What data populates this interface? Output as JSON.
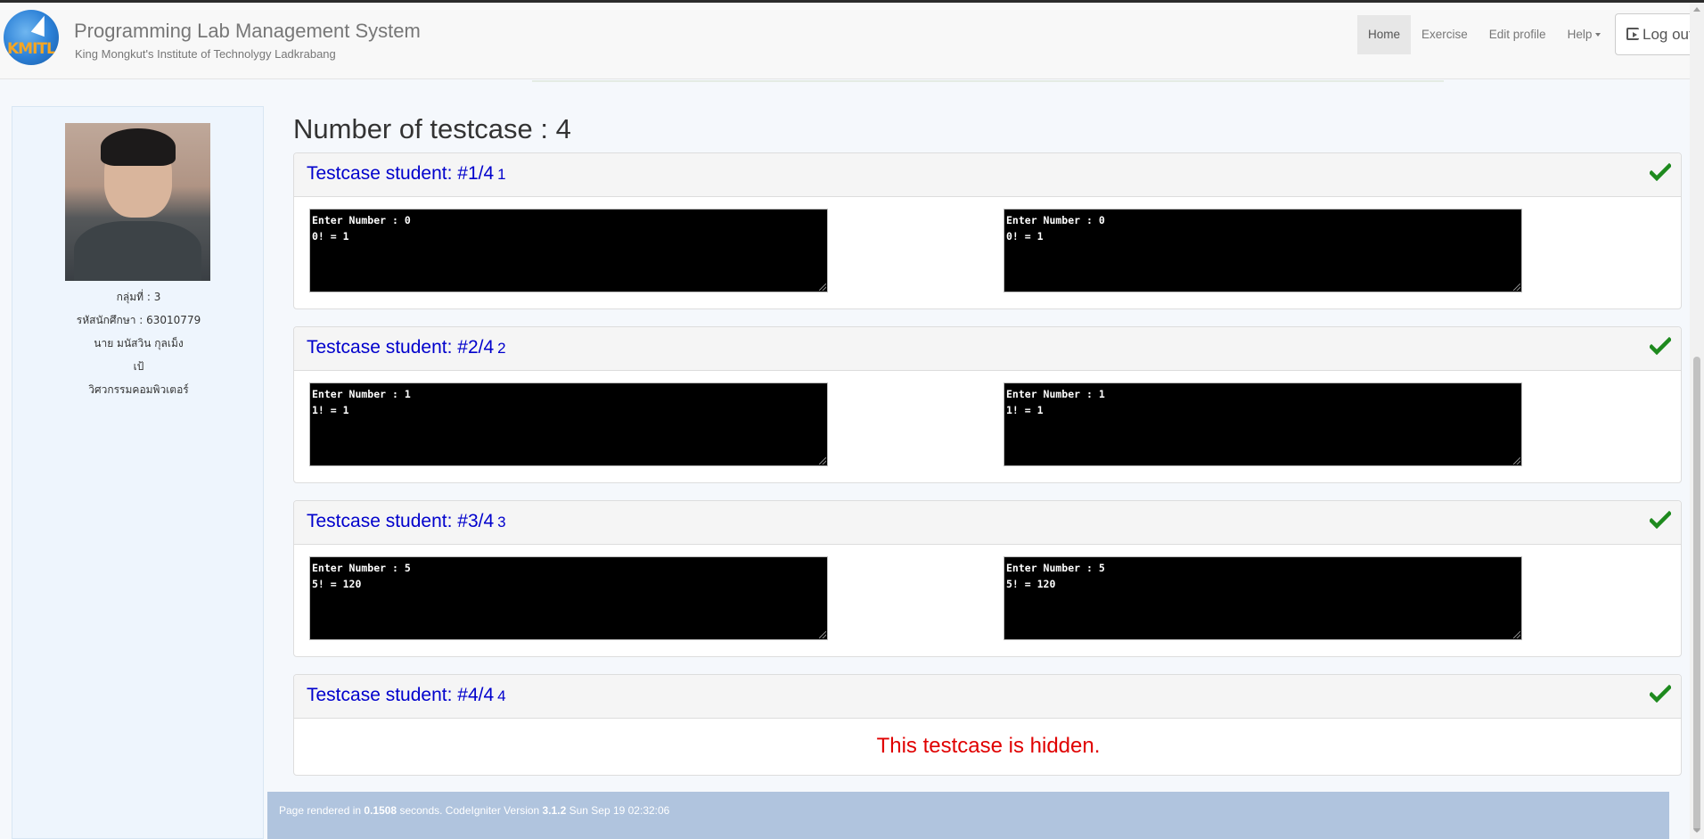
{
  "navbar": {
    "logo_text": "KMITL",
    "title": "Programming Lab Management System",
    "subtitle": "King Mongkut's Institute of Technolygy Ladkrabang",
    "links": [
      {
        "label": "Home",
        "active": true
      },
      {
        "label": "Exercise",
        "active": false
      },
      {
        "label": "Edit profile",
        "active": false
      },
      {
        "label": "Help",
        "active": false
      }
    ],
    "logout_label": "Log out"
  },
  "profile": {
    "group": "กลุ่มที่ : 3",
    "student_id": "รหัสนักศึกษา : 63010779",
    "name": "นาย มนัสวิน กุลเม็ง",
    "nickname": "เป้",
    "department": "วิศวกรรมคอมพิวเตอร์"
  },
  "main": {
    "testcase_count": "Number of testcase : 4",
    "testcases": [
      {
        "title": "Testcase student: #1/4",
        "num": "1",
        "status": "passed",
        "left_output": "Enter Number : 0\n0! = 1",
        "right_output": "Enter Number : 0\n0! = 1"
      },
      {
        "title": "Testcase student: #2/4",
        "num": "2",
        "status": "passed",
        "left_output": "Enter Number : 1\n1! = 1",
        "right_output": "Enter Number : 1\n1! = 1"
      },
      {
        "title": "Testcase student: #3/4",
        "num": "3",
        "status": "passed",
        "left_output": "Enter Number : 5\n5! = 120",
        "right_output": "Enter Number : 5\n5! = 120"
      },
      {
        "title": "Testcase student: #4/4",
        "num": "4",
        "status": "passed",
        "hidden_message": "This testcase is hidden."
      }
    ]
  },
  "footer": {
    "prefix": "Page rendered in ",
    "time": "0.1508",
    "middle": " seconds. CodeIgniter Version ",
    "version": "3.1.2",
    "date": " Sun Sep 19 02:32:06"
  },
  "colors": {
    "link_blue": "#0000cc",
    "check_green": "#1e8a1e",
    "hidden_red": "#e00000",
    "footer_bg": "#b0c4de",
    "sidebar_bg": "#eef5fd"
  }
}
